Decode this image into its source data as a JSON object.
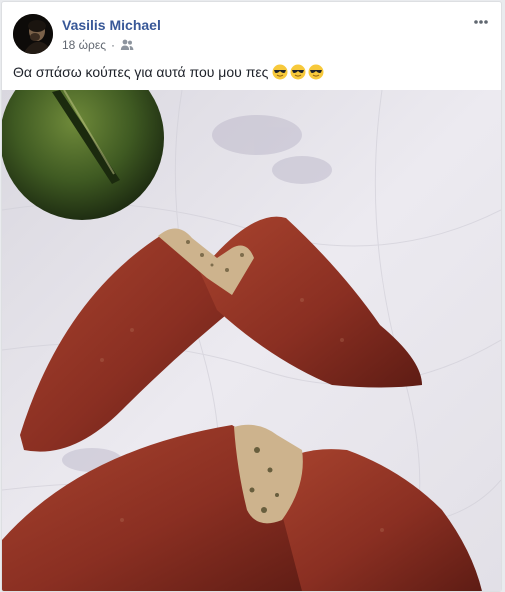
{
  "post": {
    "author": "Vasilis Michael",
    "time": "18 ώρες",
    "separator": "·",
    "audience_icon": "friends-icon",
    "text": "Θα σπάσω κούπες για αυτά που μου πες",
    "emojis": [
      "sunglasses-emoji",
      "sunglasses-emoji",
      "sunglasses-emoji"
    ],
    "more_icon": "more-options-icon"
  },
  "colors": {
    "author": "#385898",
    "meta": "#616770",
    "text": "#1d2129",
    "pastry": "#8a2f22",
    "lime": "#3f5a22"
  }
}
